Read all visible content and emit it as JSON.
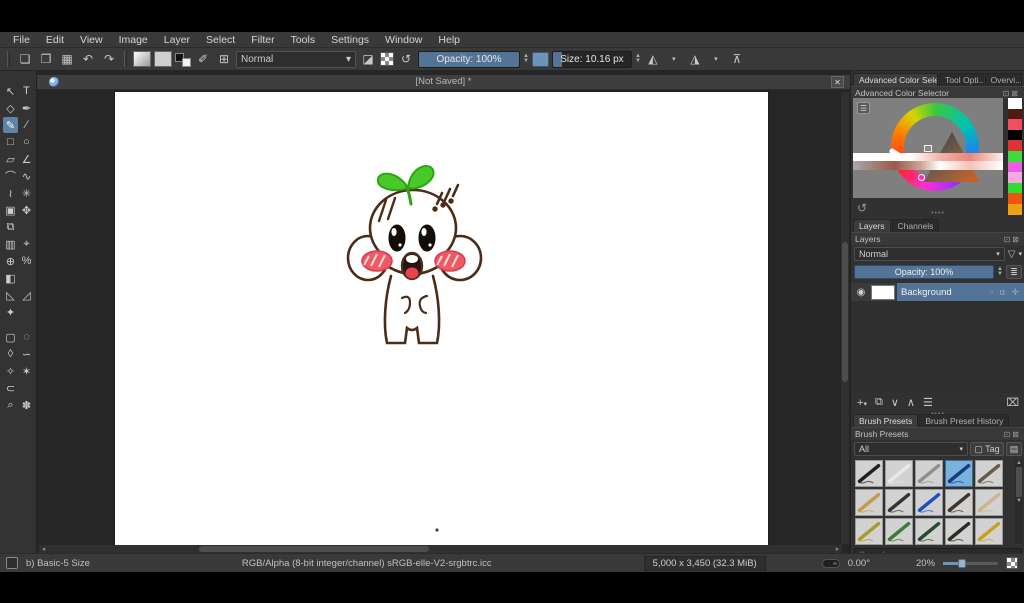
{
  "menu": {
    "items": [
      "File",
      "Edit",
      "View",
      "Image",
      "Layer",
      "Select",
      "Filter",
      "Tools",
      "Settings",
      "Window",
      "Help"
    ]
  },
  "toolbar": {
    "blend_mode": "Normal",
    "opacity_label": "Opacity: 100%",
    "size_label": "Size: 10.16 px",
    "icons": {
      "new": "❏",
      "open": "❒",
      "save": "▦",
      "undo": "↶",
      "redo": "↷",
      "brush_editor": "✐",
      "preset_grid": "⊞",
      "eraser": "◪",
      "reload": "↺",
      "mirror_h": "◭",
      "mirror_v": "◮",
      "wrap": "⊼",
      "dropdown": "▾"
    }
  },
  "toolbox": {
    "tools": [
      {
        "name": "transform-select-tool",
        "glyph": "↖"
      },
      {
        "name": "text-tool",
        "glyph": "T"
      },
      {
        "name": "edit-shapes-tool",
        "glyph": "◇"
      },
      {
        "name": "calligraphy-tool",
        "glyph": "✒"
      },
      {
        "name": "freehand-brush-tool",
        "glyph": "✎",
        "sel": true
      },
      {
        "name": "line-tool",
        "glyph": "∕"
      },
      {
        "name": "rectangle-tool",
        "glyph": "□"
      },
      {
        "name": "ellipse-tool",
        "glyph": "○"
      },
      {
        "name": "polygon-tool",
        "glyph": "▱"
      },
      {
        "name": "polyline-tool",
        "glyph": "∠"
      },
      {
        "name": "bezier-curve-tool",
        "glyph": "⌒"
      },
      {
        "name": "freehand-path-tool",
        "glyph": "∿"
      },
      {
        "name": "dynamic-brush-tool",
        "glyph": "≀"
      },
      {
        "name": "multibrush-tool",
        "glyph": "✳"
      },
      {
        "name": "transform-tool",
        "glyph": "▣"
      },
      {
        "name": "move-tool",
        "glyph": "✥"
      },
      {
        "name": "crop-tool",
        "glyph": "⧉"
      },
      {
        "name": "spacer",
        "glyph": ""
      },
      {
        "name": "gradient-tool",
        "glyph": "▥"
      },
      {
        "name": "color-sampler-tool",
        "glyph": "⌖"
      },
      {
        "name": "smart-patch-tool",
        "glyph": "⊕"
      },
      {
        "name": "colorize-mask-tool",
        "glyph": "%"
      },
      {
        "name": "fill-tool",
        "glyph": "◧"
      },
      {
        "name": "spacer",
        "glyph": ""
      },
      {
        "name": "assistants-tool",
        "glyph": "◺"
      },
      {
        "name": "measure-tool",
        "glyph": "◿"
      },
      {
        "name": "reference-images-tool",
        "glyph": "✦"
      },
      {
        "name": "spacer",
        "glyph": ""
      },
      {
        "name": "rect-select-tool",
        "glyph": "▢",
        "gap": true
      },
      {
        "name": "ellipse-select-tool",
        "glyph": "◌",
        "gap": true
      },
      {
        "name": "polygonal-select-tool",
        "glyph": "◊"
      },
      {
        "name": "freehand-select-tool",
        "glyph": "∽"
      },
      {
        "name": "similar-select-tool",
        "glyph": "✧"
      },
      {
        "name": "bezier-select-tool",
        "glyph": "✶"
      },
      {
        "name": "magnetic-select-tool",
        "glyph": "⊂"
      },
      {
        "name": "spacer",
        "glyph": ""
      },
      {
        "name": "zoom-tool",
        "glyph": "⌕"
      },
      {
        "name": "pan-tool",
        "glyph": "✽"
      }
    ]
  },
  "canvas": {
    "title": "[Not Saved] *",
    "close_glyph": "✕",
    "drawing": "sprout-head-baby-doodle"
  },
  "color_selector": {
    "tab_advanced": "Advanced Color Selec...",
    "tab_tool_options": "Tool Opti...",
    "tab_overview": "Overvi...",
    "header": "Advanced Color Selector",
    "swatches": [
      "#ffffff",
      "#4a1d0e",
      "#ef4f60",
      "#000000",
      "#dc3434",
      "#3bdc3b",
      "#ee5ce2",
      "#f6a8e2",
      "#2fdc2f",
      "#ee5510",
      "#eea012"
    ]
  },
  "layers": {
    "tab_layers": "Layers",
    "tab_channels": "Channels",
    "header": "Layers",
    "blend_mode": "Normal",
    "opacity_label": "Opacity:  100%",
    "layer_name": "Background",
    "controls": {
      "add": "+",
      "duplicate": "⧉",
      "down": "∨",
      "up": "∧",
      "props": "☰",
      "delete": "⌧"
    }
  },
  "brush_presets": {
    "tab_presets": "Brush Presets",
    "tab_history": "Brush Preset History",
    "header": "Brush Presets",
    "filter_value": "All",
    "tag_label": "Tag",
    "search_placeholder": "Search",
    "tiles": [
      {
        "name": "preset-ink-pen",
        "c": "#202020"
      },
      {
        "name": "preset-soft-brush",
        "c": "#e9e9e9"
      },
      {
        "name": "preset-wet-brush",
        "c": "#8f8f8f"
      },
      {
        "name": "preset-ink-pen-25",
        "c": "#173a80",
        "sel": true
      },
      {
        "name": "preset-pencil-2b",
        "c": "#6a5a4a"
      },
      {
        "name": "preset-pencil-hb",
        "c": "#c8984e"
      },
      {
        "name": "preset-pencil-4b",
        "c": "#39332e"
      },
      {
        "name": "preset-pencil-blue",
        "c": "#2050c0"
      },
      {
        "name": "preset-marker-dark",
        "c": "#40342a"
      },
      {
        "name": "preset-pencil-soft",
        "c": "#cdb48c"
      },
      {
        "name": "preset-pen-multi",
        "c": "#aa9a30"
      },
      {
        "name": "preset-pen-green",
        "c": "#3a7a3a"
      },
      {
        "name": "preset-marker-green",
        "c": "#2a4a30"
      },
      {
        "name": "preset-pen-dark",
        "c": "#2e2a24"
      },
      {
        "name": "preset-pen-yellow",
        "c": "#c7a020"
      }
    ]
  },
  "status": {
    "brush_name": "b) Basic-5 Size",
    "color_profile": "RGB/Alpha (8-bit integer/channel)  sRGB-elle-V2-srgbtrc.icc",
    "doc_size": "5,000 x 3,450 (32.3 MiB)",
    "rotation": "0.00°",
    "zoom": "20%"
  }
}
